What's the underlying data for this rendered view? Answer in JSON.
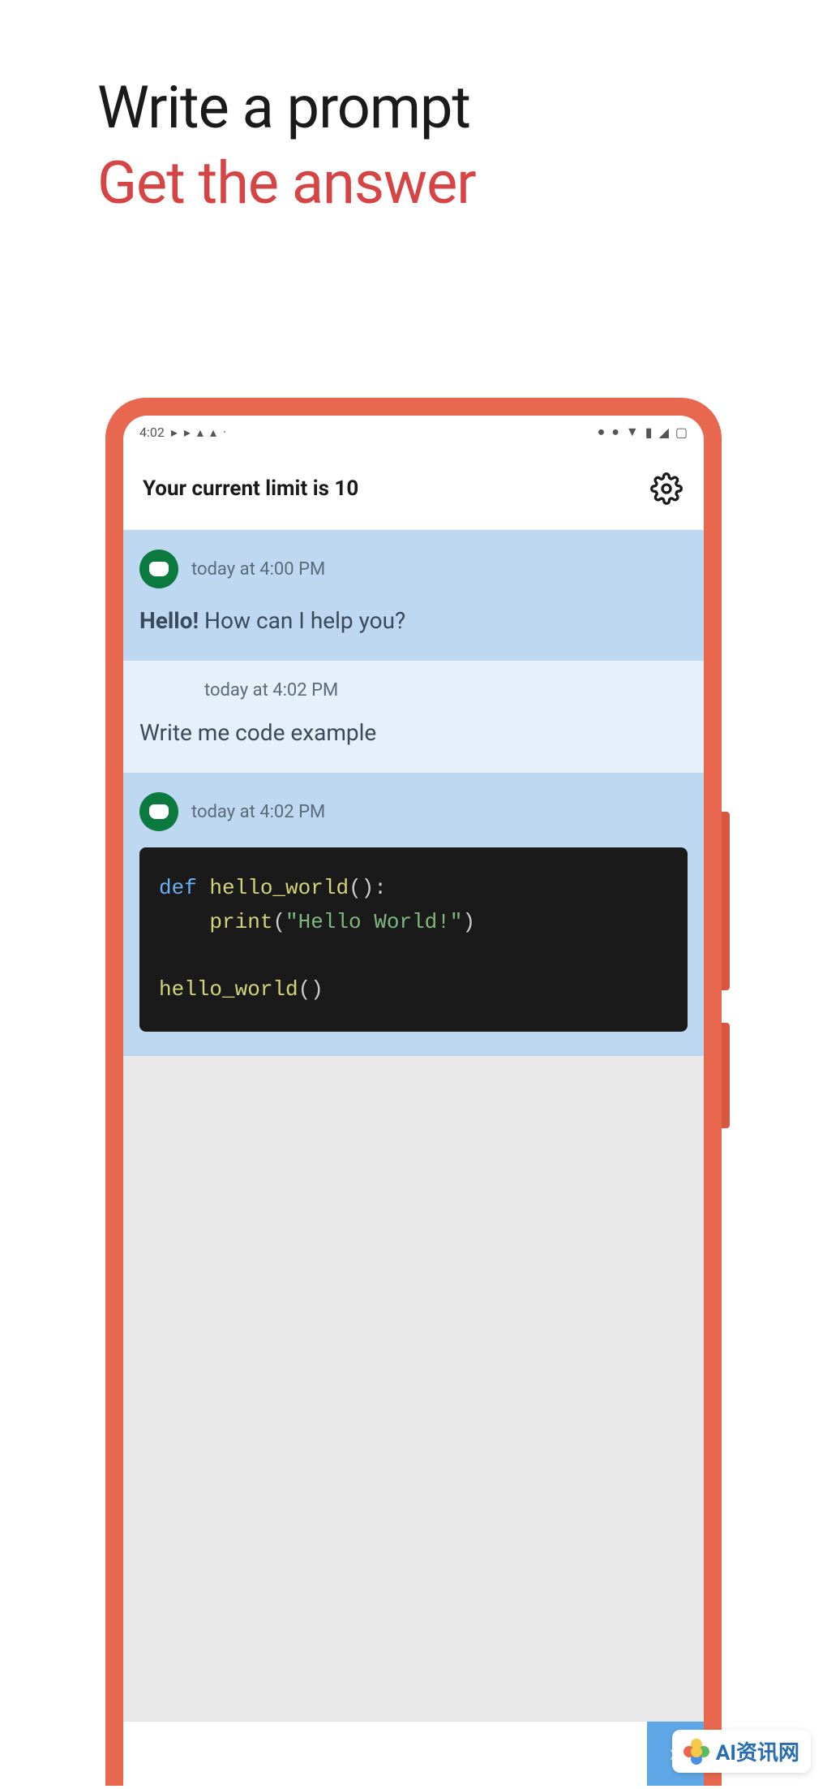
{
  "hero": {
    "line1": "Write a prompt",
    "line2": "Get the answer"
  },
  "statusBar": {
    "time": "4:02",
    "leftIcons": [
      "▸",
      "▸",
      "▴",
      "▴",
      "·"
    ],
    "rightIcons": [
      "●",
      "●",
      "▼",
      "▮",
      "◢",
      "▢"
    ]
  },
  "header": {
    "title": "Your current limit is 10"
  },
  "messages": [
    {
      "type": "bot",
      "time": "today at 4:00 PM",
      "textBold": "Hello!",
      "text": " How can I help you?"
    },
    {
      "type": "user",
      "time": "today at 4:02 PM",
      "text": "Write me code example"
    },
    {
      "type": "bot",
      "time": "today at 4:02 PM",
      "code": {
        "line1_kw": "def ",
        "line1_fn": "hello_world",
        "line1_paren": "():",
        "line2_indent": "    ",
        "line2_fn": "print",
        "line2_paren_open": "(",
        "line2_str": "\"Hello World!\"",
        "line2_paren_close": ")",
        "line3_fn": "hello_world",
        "line3_paren": "()"
      }
    }
  ],
  "input": {
    "sendLabel": ""
  },
  "watermark": {
    "text": "AI资讯网"
  }
}
